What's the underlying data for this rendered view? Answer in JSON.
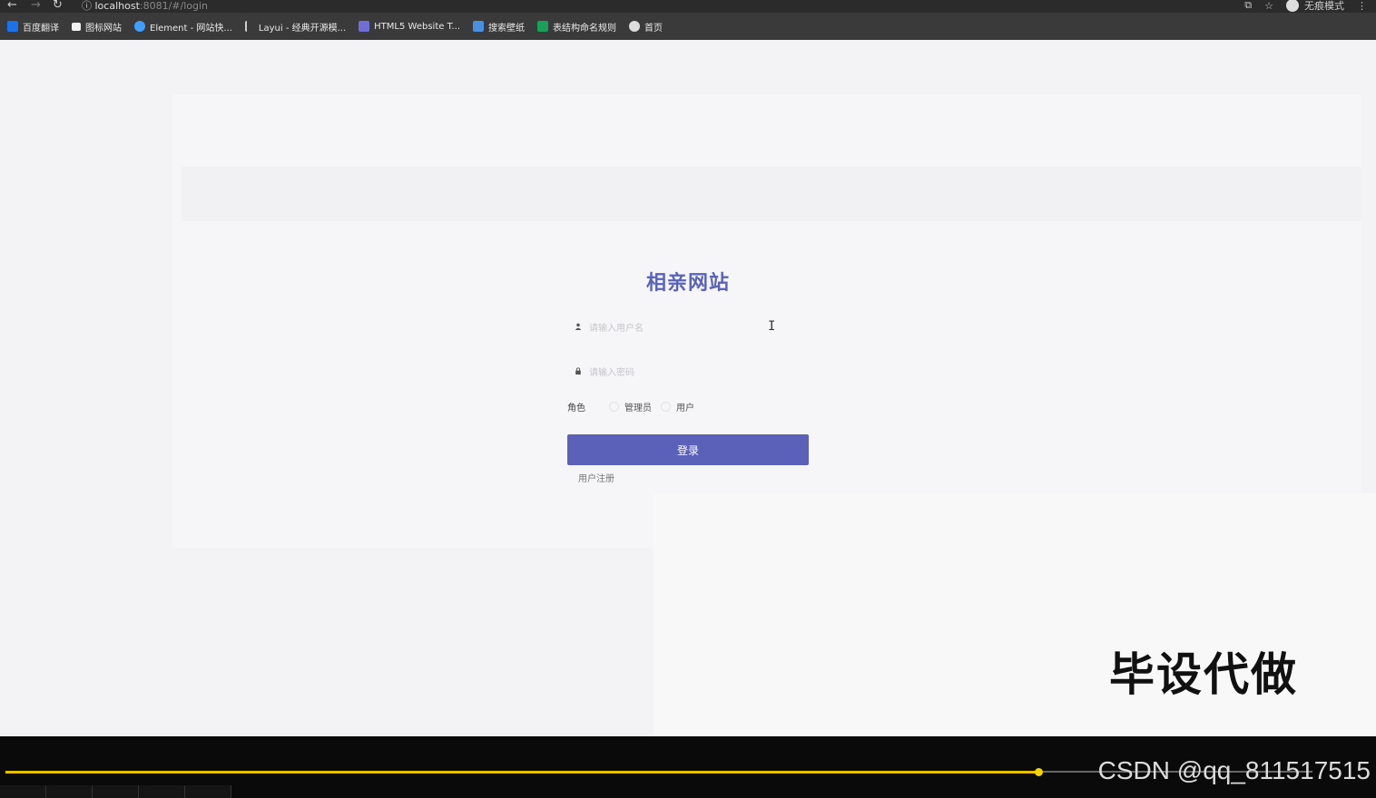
{
  "browser": {
    "url_host": "localhost",
    "url_rest": ":8081/#/login",
    "incognito_label": "无痕模式"
  },
  "bookmarks": [
    {
      "label": "百度翻译",
      "icon": "baidu-translate-icon",
      "color": "#1a73e8"
    },
    {
      "label": "图标网站",
      "icon": "flag-icon",
      "color": "#ffffff"
    },
    {
      "label": "Element - 网站快...",
      "icon": "element-icon",
      "color": "#409eff"
    },
    {
      "label": "Layui - 经典开源模...",
      "icon": "layui-icon",
      "color": "#cccccc"
    },
    {
      "label": "HTML5 Website T...",
      "icon": "html5-icon",
      "color": "#6f6fd6"
    },
    {
      "label": "搜索壁纸",
      "icon": "wallpaper-icon",
      "color": "#4a90e2"
    },
    {
      "label": "表结构命名规则",
      "icon": "table-icon",
      "color": "#19a05a"
    },
    {
      "label": "首页",
      "icon": "globe-icon",
      "color": "#dddddd"
    }
  ],
  "login": {
    "title": "相亲网站",
    "username_placeholder": "请输入用户名",
    "password_placeholder": "请输入密码",
    "role_label": "角色",
    "role_options": [
      "管理员",
      "用户"
    ],
    "login_button": "登录",
    "register_link": "用户注册"
  },
  "overlay": {
    "watermark": "毕设代做",
    "csdn": "CSDN @qq_811517515"
  },
  "player": {
    "progress": 0.79
  },
  "colors": {
    "accent": "#5b60b8",
    "title": "#5a63b8",
    "progress": "#e3c100"
  }
}
